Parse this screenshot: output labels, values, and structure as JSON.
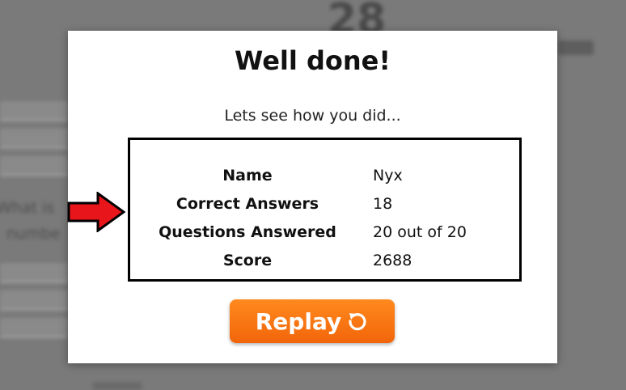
{
  "background": {
    "timer": "28",
    "question_partial": "What is",
    "question_partial_2": "numbe"
  },
  "modal": {
    "title": "Well done!",
    "subtitle": "Lets see how you did...",
    "results": [
      {
        "label": "Name",
        "value": "Nyx"
      },
      {
        "label": "Correct Answers",
        "value": "18"
      },
      {
        "label": "Questions Answered",
        "value": "20 out of 20"
      },
      {
        "label": "Score",
        "value": "2688"
      }
    ],
    "replay_label": "Replay",
    "replay_icon": "replay-icon"
  },
  "colors": {
    "accent": "#f57213",
    "arrow": "#e8151b"
  }
}
